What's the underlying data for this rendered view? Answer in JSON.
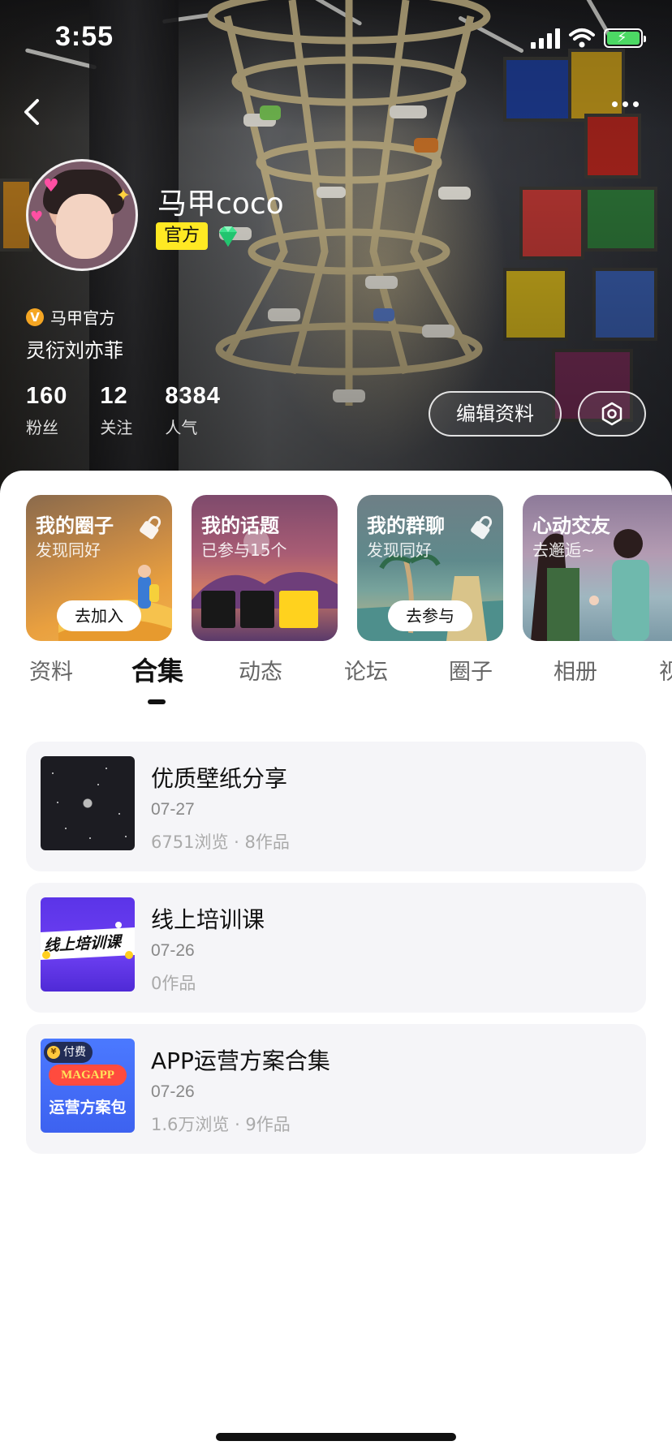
{
  "status_bar": {
    "time": "3:55"
  },
  "profile": {
    "name": "马甲coco",
    "badge": "官方",
    "verified_label": "马甲官方",
    "bio": "灵衍刘亦菲",
    "stats": [
      {
        "value": "160",
        "label": "粉丝"
      },
      {
        "value": "12",
        "label": "关注"
      },
      {
        "value": "8384",
        "label": "人气"
      }
    ],
    "edit_label": "编辑资料"
  },
  "cards": [
    {
      "title": "我的圈子",
      "subtitle": "发现同好",
      "action": "去加入"
    },
    {
      "title": "我的话题",
      "subtitle": "已参与15个"
    },
    {
      "title": "我的群聊",
      "subtitle": "发现同好",
      "action": "去参与"
    },
    {
      "title": "心动交友",
      "subtitle": "去邂逅~"
    }
  ],
  "tabs": [
    {
      "label": "资料"
    },
    {
      "label": "合集",
      "active": true
    },
    {
      "label": "动态"
    },
    {
      "label": "论坛"
    },
    {
      "label": "圈子"
    },
    {
      "label": "相册"
    },
    {
      "label": "视"
    }
  ],
  "collections": [
    {
      "title": "优质壁纸分享",
      "date": "07-27",
      "meta": "6751浏览 · 8作品"
    },
    {
      "title": "线上培训课",
      "date": "07-26",
      "meta": "0作品",
      "thumb_text": "线上培训课"
    },
    {
      "title": "APP运营方案合集",
      "date": "07-26",
      "meta": "1.6万浏览 · 9作品",
      "thumb": {
        "paid_label": "付费",
        "brand": "MAGAPP",
        "caption": "运营方案包"
      }
    }
  ],
  "colors": {
    "official_badge": "#ffe923",
    "verify": "#f5a623",
    "accent_text": "#111111"
  }
}
